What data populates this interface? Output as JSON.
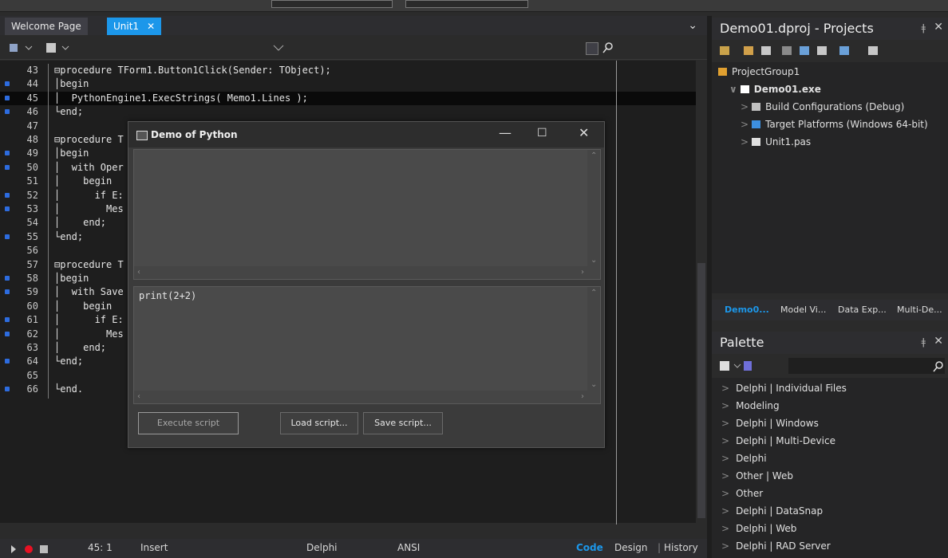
{
  "editor_tabs": [
    {
      "label": "Welcome Page"
    },
    {
      "label": "Unit1"
    }
  ],
  "tab_close_glyph": "✕",
  "code_lines": [
    {
      "num": "43",
      "bp": false,
      "code": "⊟procedure TForm1.Button1Click(Sender: TObject);"
    },
    {
      "num": "44",
      "bp": true,
      "code": "│begin"
    },
    {
      "num": "45",
      "bp": true,
      "code": "│  PythonEngine1.ExecStrings( Memo1.Lines );"
    },
    {
      "num": "46",
      "bp": true,
      "code": "└end;"
    },
    {
      "num": "47",
      "bp": false,
      "code": ""
    },
    {
      "num": "48",
      "bp": false,
      "code": "⊟procedure T"
    },
    {
      "num": "49",
      "bp": true,
      "code": "│begin"
    },
    {
      "num": "50",
      "bp": true,
      "code": "│  with Oper"
    },
    {
      "num": "51",
      "bp": false,
      "code": "│    begin"
    },
    {
      "num": "52",
      "bp": true,
      "code": "│      if E:"
    },
    {
      "num": "53",
      "bp": true,
      "code": "│        Mes"
    },
    {
      "num": "54",
      "bp": false,
      "code": "│    end;"
    },
    {
      "num": "55",
      "bp": true,
      "code": "└end;"
    },
    {
      "num": "56",
      "bp": false,
      "code": ""
    },
    {
      "num": "57",
      "bp": false,
      "code": "⊟procedure T"
    },
    {
      "num": "58",
      "bp": true,
      "code": "│begin"
    },
    {
      "num": "59",
      "bp": true,
      "code": "│  with Save"
    },
    {
      "num": "60",
      "bp": false,
      "code": "│    begin"
    },
    {
      "num": "61",
      "bp": true,
      "code": "│      if E:"
    },
    {
      "num": "62",
      "bp": true,
      "code": "│        Mes"
    },
    {
      "num": "63",
      "bp": false,
      "code": "│    end;"
    },
    {
      "num": "64",
      "bp": true,
      "code": "└end;"
    },
    {
      "num": "65",
      "bp": false,
      "code": ""
    },
    {
      "num": "66",
      "bp": true,
      "code": "└end."
    }
  ],
  "highlighted_line": "45",
  "statusbar": {
    "position": "45: 1",
    "mode": "Insert",
    "language": "Delphi",
    "encoding": "ANSI",
    "view_code": "Code",
    "view_design": "Design",
    "view_history": "History"
  },
  "popup": {
    "title": "Demo of Python",
    "minimize": "—",
    "maximize": "☐",
    "close": "✕",
    "output_text": "",
    "script_text": "print(2+2)",
    "execute_label": "Execute script",
    "load_label": "Load script...",
    "save_label": "Save script..."
  },
  "projects": {
    "title": "Demo01.dproj - Projects",
    "pin": "📌",
    "close": "✕",
    "tree": [
      {
        "label": "ProjectGroup1",
        "indent": 0,
        "bold": false,
        "expander": ""
      },
      {
        "label": "Demo01.exe",
        "indent": 1,
        "bold": true,
        "expander": "∨"
      },
      {
        "label": "Build Configurations (Debug)",
        "indent": 2,
        "bold": false,
        "expander": ">"
      },
      {
        "label": "Target Platforms (Windows 64-bit)",
        "indent": 2,
        "bold": false,
        "expander": ">"
      },
      {
        "label": "Unit1.pas",
        "indent": 2,
        "bold": false,
        "expander": ">"
      }
    ],
    "tabs": [
      "Demo0...",
      "Model Vi...",
      "Data Exp...",
      "Multi-De..."
    ]
  },
  "palette": {
    "title": "Palette",
    "items": [
      "Delphi | Individual Files",
      "Modeling",
      "Delphi | Windows",
      "Delphi | Multi-Device",
      "Delphi",
      "Other | Web",
      "Other",
      "Delphi | DataSnap",
      "Delphi | Web",
      "Delphi | RAD Server"
    ]
  },
  "colors": {
    "accent": "#1c97ea",
    "breakpoint": "#2d6cdf",
    "stop": "#e81123"
  }
}
